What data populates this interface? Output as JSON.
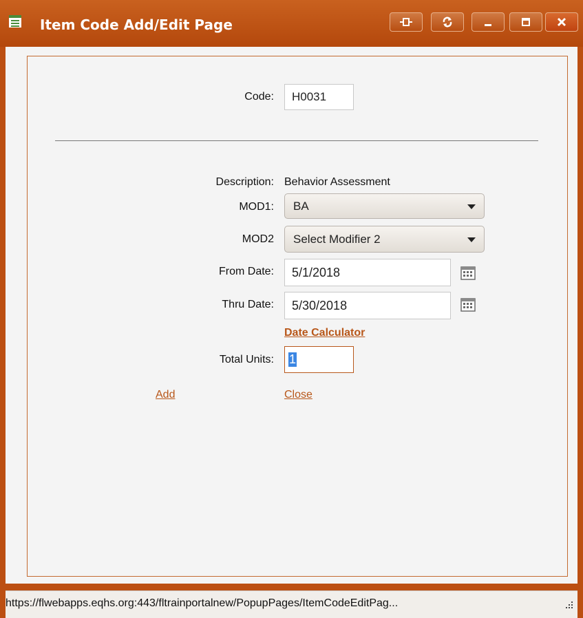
{
  "window": {
    "title": "Item Code Add/Edit Page",
    "accent_color": "#bc4f12",
    "title_icon": "window-list-icon",
    "buttons": [
      {
        "name": "pin-button",
        "icon": "pin-icon"
      },
      {
        "name": "refresh-button",
        "icon": "refresh-icon"
      },
      {
        "name": "minimize-button",
        "icon": "minimize-icon"
      },
      {
        "name": "maximize-button",
        "icon": "maximize-icon"
      },
      {
        "name": "close-button",
        "icon": "close-icon"
      }
    ]
  },
  "form": {
    "code_label": "Code:",
    "code_value": "H0031",
    "description_label": "Description:",
    "description_value": "Behavior Assessment",
    "mod1_label": "MOD1:",
    "mod1_value": "BA",
    "mod2_label": "MOD2",
    "mod2_value": "Select Modifier 2",
    "from_date_label": "From Date:",
    "from_date_value": "5/1/2018",
    "thru_date_label": "Thru Date:",
    "thru_date_value": "5/30/2018",
    "date_calculator_label": "Date Calculator",
    "total_units_label": "Total Units:",
    "total_units_value": "1",
    "add_label": "Add",
    "close_label": "Close"
  },
  "status": {
    "url": "https://flwebapps.eqhs.org:443/fltrainportalnew/PopupPages/ItemCodeEditPag..."
  }
}
